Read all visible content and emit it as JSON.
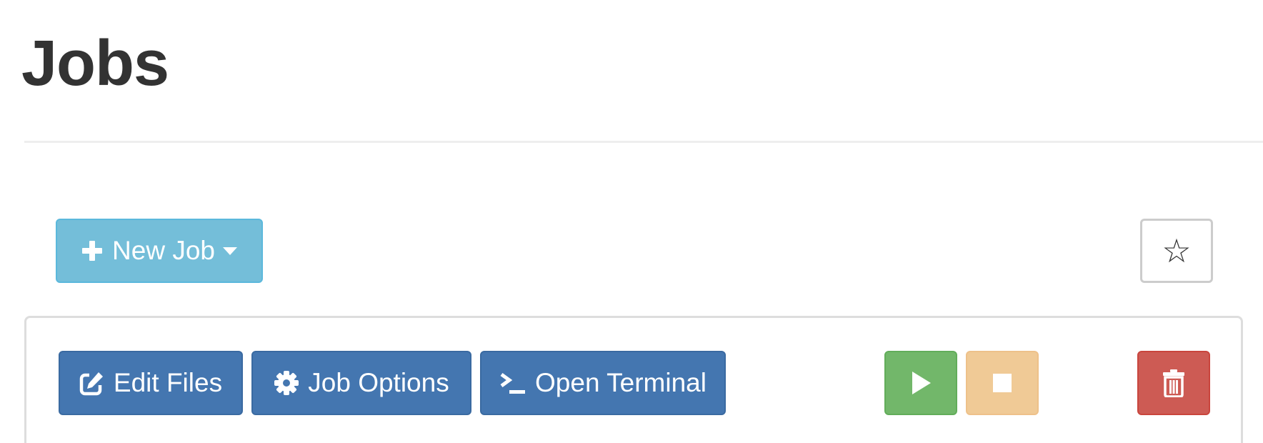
{
  "page": {
    "title": "Jobs"
  },
  "toolbar": {
    "new_job_label": "New Job",
    "new_job_icon": "plus-icon",
    "new_job_caret_icon": "caret-down-icon",
    "favorite_icon": "star-icon",
    "favorite_glyph": "☆"
  },
  "job_actions": {
    "edit_files_label": "Edit Files",
    "edit_files_icon": "edit-icon",
    "job_options_label": "Job Options",
    "job_options_icon": "gear-icon",
    "open_terminal_label": "Open Terminal",
    "open_terminal_icon": "terminal-icon",
    "run_icon": "play-icon",
    "stop_icon": "stop-icon",
    "delete_icon": "trash-icon"
  },
  "colors": {
    "info": "#74bed9",
    "primary": "#4476b0",
    "success": "#72b76a",
    "warning": "#f0ca96",
    "danger": "#cd5b54"
  }
}
